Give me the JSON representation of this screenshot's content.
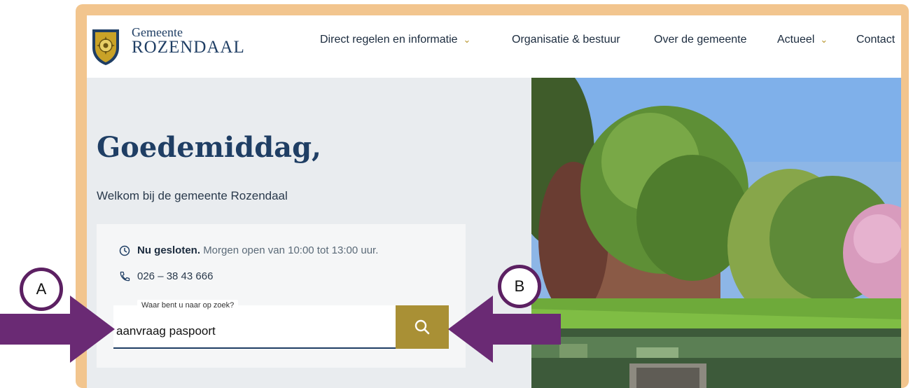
{
  "header": {
    "logo_line1": "Gemeente",
    "logo_line2": "ROZENDAAL",
    "nav": [
      {
        "label": "Direct regelen en informatie",
        "has_dropdown": true
      },
      {
        "label": "Organisatie & bestuur",
        "has_dropdown": false
      },
      {
        "label": "Over de gemeente",
        "has_dropdown": false
      },
      {
        "label": "Actueel",
        "has_dropdown": true
      },
      {
        "label": "Contact",
        "has_dropdown": false
      }
    ]
  },
  "hero": {
    "greeting": "Goedemiddag,",
    "welcome": "Welkom bij de gemeente Rozendaal",
    "status_bold": "Nu gesloten.",
    "status_rest": "Morgen open van 10:00 tot 13:00 uur.",
    "phone": "026 – 38 43 666"
  },
  "search": {
    "label": "Waar bent u naar op zoek?",
    "value": "aanvraag paspoort",
    "button_icon": "search-icon"
  },
  "annotations": {
    "marker_a": "A",
    "marker_b": "B",
    "arrow_color": "#6a2a74"
  },
  "colors": {
    "brand_navy": "#1f3e64",
    "accent_gold": "#a99035",
    "frame_peach": "#f2c58e",
    "hero_bg": "#e9ecef"
  }
}
